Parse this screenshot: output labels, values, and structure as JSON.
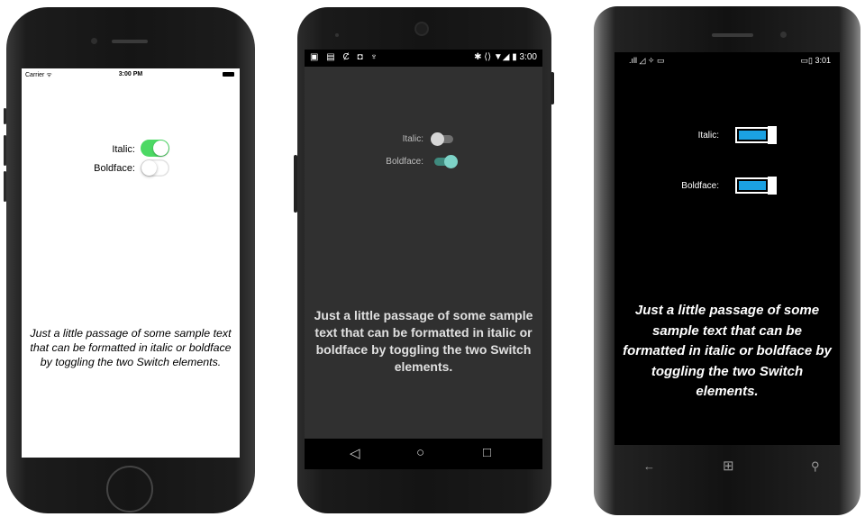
{
  "ios": {
    "carrier": "Carrier ᯤ",
    "time": "3:00 PM",
    "italic_label": "Italic:",
    "boldface_label": "Boldface:",
    "italic_on": true,
    "boldface_on": false,
    "passage": "Just a little passage of some sample text that can be formatted in italic or boldface by toggling the two Switch elements."
  },
  "android": {
    "status_left": "▣ ▤ Ȼ ◘ ♆",
    "status_right": "✱ ⟨⟩ ▼◢ ▮ 3:00",
    "italic_label": "Italic:",
    "boldface_label": "Boldface:",
    "italic_on": false,
    "boldface_on": true,
    "passage": "Just a little passage of some sample text that can be formatted in italic or boldface by toggling the two Switch elements.",
    "nav": {
      "back": "◁",
      "home": "○",
      "recents": "□"
    }
  },
  "winphone": {
    "status_left": ".ıll ◿ ✧ ▭",
    "status_right": "▭▯ 3:01",
    "italic_label": "Italic:",
    "boldface_label": "Boldface:",
    "italic_on": true,
    "boldface_on": true,
    "passage": "Just a little passage of some sample text that can be formatted in italic or boldface by toggling the two Switch elements.",
    "nav": {
      "back": "←",
      "start": "⊞",
      "search": "⚲"
    }
  },
  "colors": {
    "ios_switch_on": "#4cd964",
    "android_accent": "#7dd3c7",
    "winphone_accent": "#1ba1e2"
  }
}
